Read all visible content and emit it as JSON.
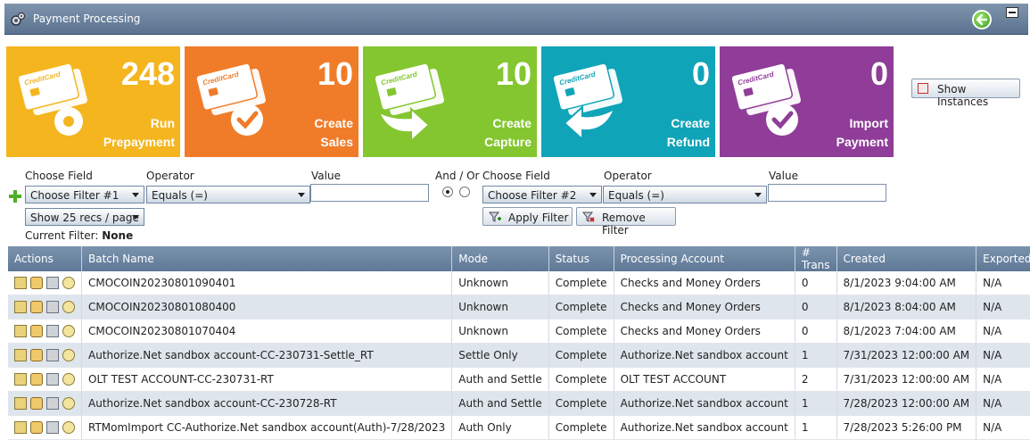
{
  "window": {
    "title": "Payment Processing"
  },
  "tiles": [
    {
      "count": "248",
      "label_line1": "Run",
      "label_line2": "Prepayment",
      "color": "#f4b51f",
      "icon": "credit-card-gear"
    },
    {
      "count": "10",
      "label_line1": "Create",
      "label_line2": "Sales",
      "color": "#f07c2a",
      "icon": "credit-card-check"
    },
    {
      "count": "10",
      "label_line1": "Create",
      "label_line2": "Capture",
      "color": "#84c630",
      "icon": "credit-card-arrow-right"
    },
    {
      "count": "0",
      "label_line1": "Create",
      "label_line2": "Refund",
      "color": "#10a4b8",
      "icon": "credit-card-arrow-left"
    },
    {
      "count": "0",
      "label_line1": "Import",
      "label_line2": "Payment",
      "color": "#8f3d98",
      "icon": "credit-card-check"
    }
  ],
  "card_text": "CreditCard",
  "show_instances_label": "Show Instances",
  "filter": {
    "choose_field_label": "Choose Field",
    "operator_label": "Operator",
    "value_label": "Value",
    "and_or_label": "And / Or",
    "field1": "Choose Filter #1",
    "field2": "Choose Filter #2",
    "operator1": "Equals (=)",
    "operator2": "Equals (=)",
    "page_size": "Show 25 recs / page",
    "apply_label": "Apply Filter",
    "remove_label": "Remove Filter",
    "current_filter_label": "Current Filter:",
    "current_filter_value": "None"
  },
  "table": {
    "headers": [
      "Actions",
      "Batch Name",
      "Mode",
      "Status",
      "Processing Account",
      "# Trans",
      "Created",
      "Exported?"
    ],
    "rows": [
      [
        "CMOCOIN20230801090401",
        "Unknown",
        "Complete",
        "Checks and Money Orders",
        "0",
        "8/1/2023 9:04:00 AM",
        "N/A"
      ],
      [
        "CMOCOIN20230801080400",
        "Unknown",
        "Complete",
        "Checks and Money Orders",
        "0",
        "8/1/2023 8:04:00 AM",
        "N/A"
      ],
      [
        "CMOCOIN20230801070404",
        "Unknown",
        "Complete",
        "Checks and Money Orders",
        "0",
        "8/1/2023 7:04:00 AM",
        "N/A"
      ],
      [
        "Authorize.Net sandbox account-CC-230731-Settle_RT",
        "Settle Only",
        "Complete",
        "Authorize.Net sandbox account",
        "1",
        "7/31/2023 12:00:00 AM",
        "N/A"
      ],
      [
        "OLT TEST ACCOUNT-CC-230731-RT",
        "Auth and Settle",
        "Complete",
        "OLT TEST ACCOUNT",
        "2",
        "7/31/2023 12:00:00 AM",
        "N/A"
      ],
      [
        "Authorize.Net sandbox account-CC-230728-RT",
        "Auth and Settle",
        "Complete",
        "Authorize.Net sandbox account",
        "1",
        "7/28/2023 12:00:00 AM",
        "N/A"
      ],
      [
        "RTMomImport CC-Authorize.Net sandbox account(Auth)-7/28/2023",
        "Auth Only",
        "Complete",
        "Authorize.Net sandbox account",
        "1",
        "7/28/2023 5:26:00 PM",
        "N/A"
      ]
    ]
  }
}
